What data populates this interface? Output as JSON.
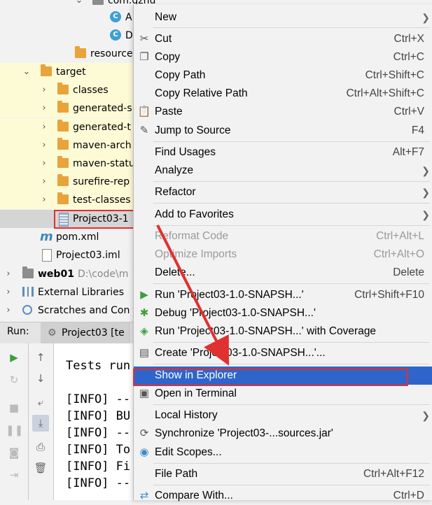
{
  "tree": {
    "package_label": "com.gzhu",
    "class_a": "A",
    "class_d": "D",
    "resources": "resource",
    "target": "target",
    "children": [
      "classes",
      "generated-s",
      "generated-t",
      "maven-arch",
      "maven-statu",
      "surefire-rep",
      "test-classes"
    ],
    "jar": "Project03-1",
    "pom": "pom.xml",
    "iml": "Project03.iml",
    "web01": "web01",
    "web01_path": "D:\\code\\m",
    "ext_libs": "External Libraries",
    "scratches": "Scratches and Con"
  },
  "run": {
    "label": "Run:",
    "tab": "Project03 [te",
    "console": [
      "Tests run",
      "",
      "[INFO] --",
      "[INFO] BU",
      "[INFO] --",
      "[INFO] To",
      "[INFO] Fi",
      "[INFO] --"
    ]
  },
  "menu": {
    "new": "New",
    "cut": "Cut",
    "cut_sc": "Ctrl+X",
    "copy": "Copy",
    "copy_sc": "Ctrl+C",
    "copy_path": "Copy Path",
    "copy_path_sc": "Ctrl+Shift+C",
    "copy_rel": "Copy Relative Path",
    "copy_rel_sc": "Ctrl+Alt+Shift+C",
    "paste": "Paste",
    "paste_sc": "Ctrl+V",
    "jump": "Jump to Source",
    "jump_sc": "F4",
    "find": "Find Usages",
    "find_sc": "Alt+F7",
    "analyze": "Analyze",
    "refactor": "Refactor",
    "favorites": "Add to Favorites",
    "reformat": "Reformat Code",
    "reformat_sc": "Ctrl+Alt+L",
    "optimize": "Optimize Imports",
    "optimize_sc": "Ctrl+Alt+O",
    "delete": "Delete...",
    "delete_sc": "Delete",
    "run": "Run 'Project03-1.0-SNAPSH...'",
    "run_sc": "Ctrl+Shift+F10",
    "debug": "Debug 'Project03-1.0-SNAPSH...'",
    "coverage": "Run 'Project03-1.0-SNAPSH...' with Coverage",
    "create": "Create 'Project03-1.0-SNAPSH...'...",
    "explorer": "Show in Explorer",
    "terminal": "Open in Terminal",
    "history": "Local History",
    "sync": "Synchronize 'Project03-...sources.jar'",
    "scopes": "Edit Scopes...",
    "filepath": "File Path",
    "filepath_sc": "Ctrl+Alt+F12",
    "compare": "Compare With...",
    "compare_sc": "Ctrl+D"
  },
  "colors": {
    "selection": "#2f65ca",
    "annotation": "#e03030",
    "folder": "#e8a33a"
  }
}
